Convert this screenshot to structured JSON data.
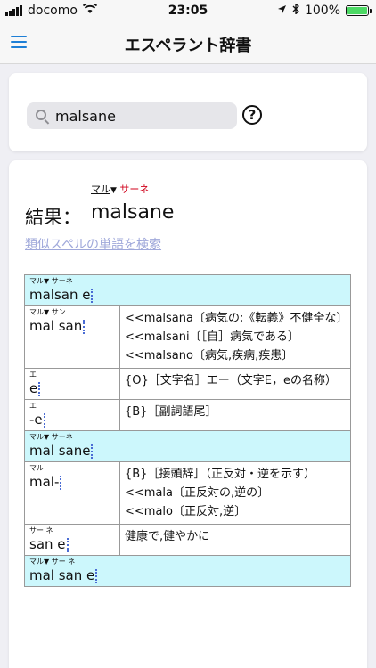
{
  "status": {
    "carrier": "docomo",
    "time": "23:05",
    "battery": "100%",
    "battery_level": 1.0
  },
  "nav": {
    "title": "エスペラント辞書"
  },
  "search": {
    "value": "malsane",
    "help": "?"
  },
  "result": {
    "label": "結果：",
    "word": "malsane",
    "ruby_black": "マル",
    "ruby_red": "サーネ",
    "similar_link": "類似スペルの単語を検索"
  },
  "table": [
    {
      "type": "head",
      "word": "malsan e",
      "ruby": "マル▼ サーネ"
    },
    {
      "type": "entry",
      "word": "mal san",
      "ruby": "マル▼ サン",
      "defs": [
        "<<malsana〔病気の;《転義》不健全な〕",
        "<<malsani〔［自］病気である〕",
        "<<malsano〔病気,疾病,疾患〕"
      ]
    },
    {
      "type": "entry",
      "word": "e",
      "ruby": "エ",
      "defs": [
        "{O}［文字名］エー（文字E，eの名称）"
      ]
    },
    {
      "type": "entry",
      "word": "-e",
      "ruby": "エ",
      "defs": [
        "{B}［副詞語尾］"
      ]
    },
    {
      "type": "head",
      "word": "mal sane",
      "ruby": "マル▼ サーネ"
    },
    {
      "type": "entry",
      "word": "mal-",
      "ruby": "マル",
      "defs": [
        "{B}［接頭辞］（正反対・逆を示す）",
        "<<mala〔正反対の,逆の〕",
        "<<malo〔正反対,逆〕"
      ]
    },
    {
      "type": "entry",
      "word": "san e",
      "ruby": "サー ネ",
      "defs": [
        "健康で,健やかに"
      ]
    },
    {
      "type": "head",
      "word": "mal san e",
      "ruby": "マル▼ サー ネ"
    }
  ]
}
